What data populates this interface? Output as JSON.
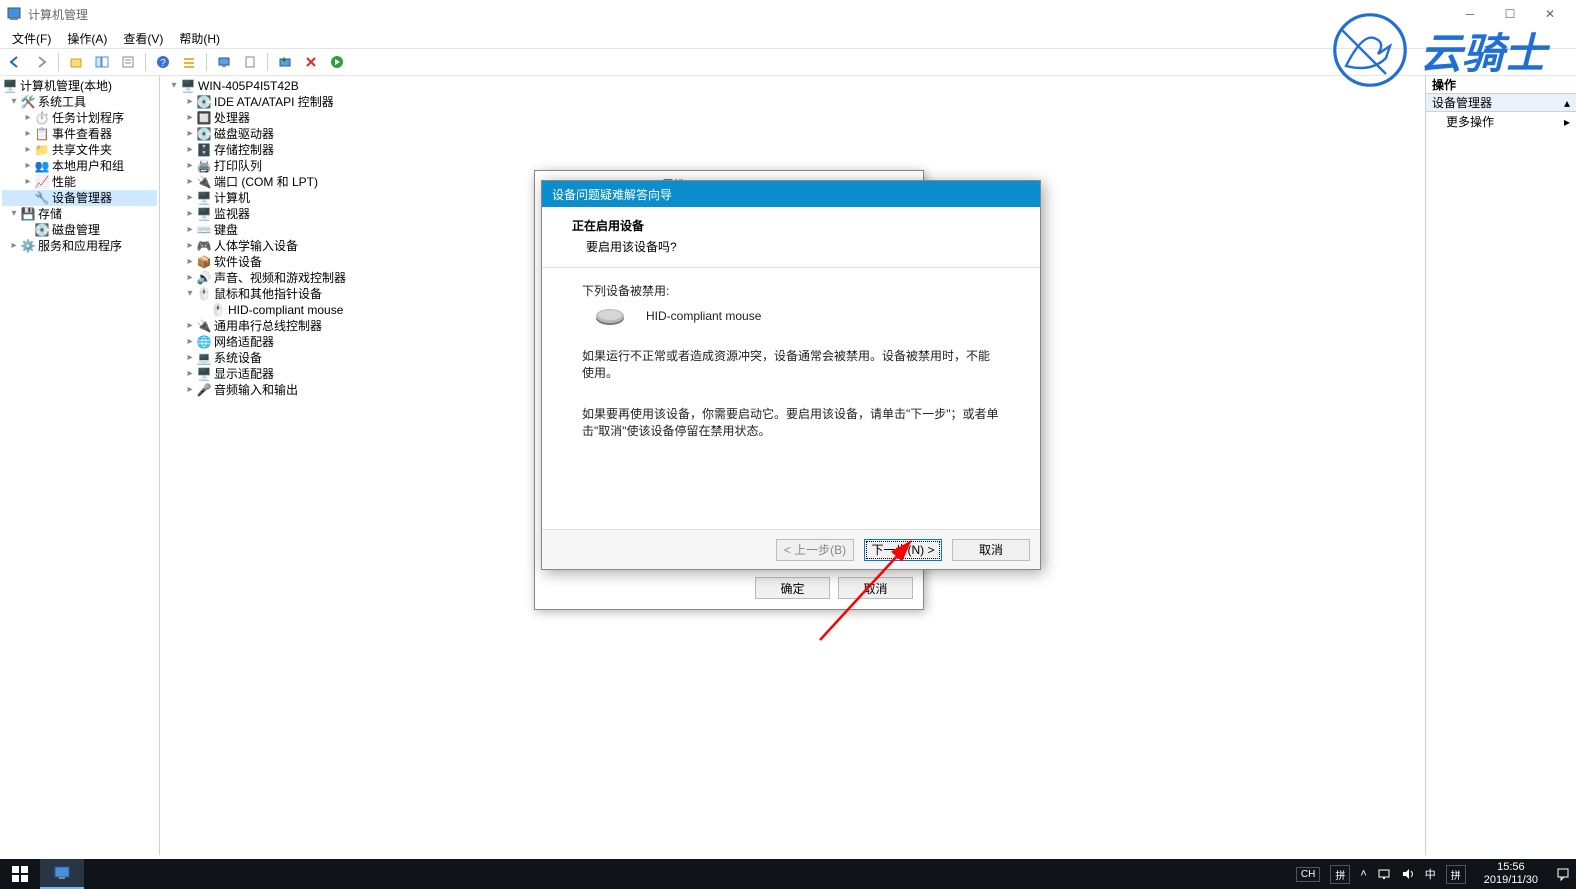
{
  "window": {
    "title": "计算机管理"
  },
  "menu": {
    "file": "文件(F)",
    "action": "操作(A)",
    "view": "查看(V)",
    "help": "帮助(H)"
  },
  "toolbar_icons": [
    "back",
    "forward",
    "sep",
    "up",
    "show-hide",
    "properties",
    "sep",
    "props2",
    "refresh",
    "sep",
    "help2",
    "list",
    "sep",
    "computer",
    "stop-red",
    "play-green"
  ],
  "left_tree": {
    "root": "计算机管理(本地)",
    "system_tools": "系统工具",
    "task_scheduler": "任务计划程序",
    "event_viewer": "事件查看器",
    "shared_folders": "共享文件夹",
    "local_users": "本地用户和组",
    "performance": "性能",
    "device_manager": "设备管理器",
    "storage": "存储",
    "disk_mgmt": "磁盘管理",
    "services_apps": "服务和应用程序"
  },
  "mid_tree": {
    "host": "WIN-405P4I5T42B",
    "ide": "IDE ATA/ATAPI 控制器",
    "cpu": "处理器",
    "disk_drives": "磁盘驱动器",
    "storage_ctrl": "存储控制器",
    "print_queue": "打印队列",
    "ports": "端口 (COM 和 LPT)",
    "computer": "计算机",
    "monitor": "监视器",
    "keyboard": "键盘",
    "hid": "人体学输入设备",
    "software_dev": "软件设备",
    "sound": "声音、视频和游戏控制器",
    "mouse_cat": "鼠标和其他指针设备",
    "mouse_item": "HID-compliant mouse",
    "usb_serial": "通用串行总线控制器",
    "network": "网络适配器",
    "system_dev": "系统设备",
    "display": "显示适配器",
    "audio_io": "音频输入和输出"
  },
  "right": {
    "header": "操作",
    "section": "设备管理器",
    "more": "更多操作"
  },
  "bg_dialog": {
    "title": "HID-compliant mouse 属性",
    "ok": "确定",
    "cancel": "取消"
  },
  "wizard": {
    "title": "设备问题疑难解答向导",
    "heading": "正在启用设备",
    "subheading": "要启用该设备吗?",
    "disabled_label": "下列设备被禁用:",
    "device_name": "HID-compliant mouse",
    "msg1": "如果运行不正常或者造成资源冲突，设备通常会被禁用。设备被禁用时，不能使用。",
    "msg2": "如果要再使用该设备，你需要启动它。要启用该设备，请单击\"下一步\"；或者单击\"取消\"使该设备停留在禁用状态。",
    "back": "< 上一步(B)",
    "next": "下一步(N) >",
    "cancel": "取消"
  },
  "logo_text": "云骑士",
  "taskbar": {
    "ime_lang": "CH",
    "ime_mode": "中",
    "ime_sym": "拼",
    "ime_full": "拼",
    "time": "15:56",
    "date": "2019/11/30"
  }
}
